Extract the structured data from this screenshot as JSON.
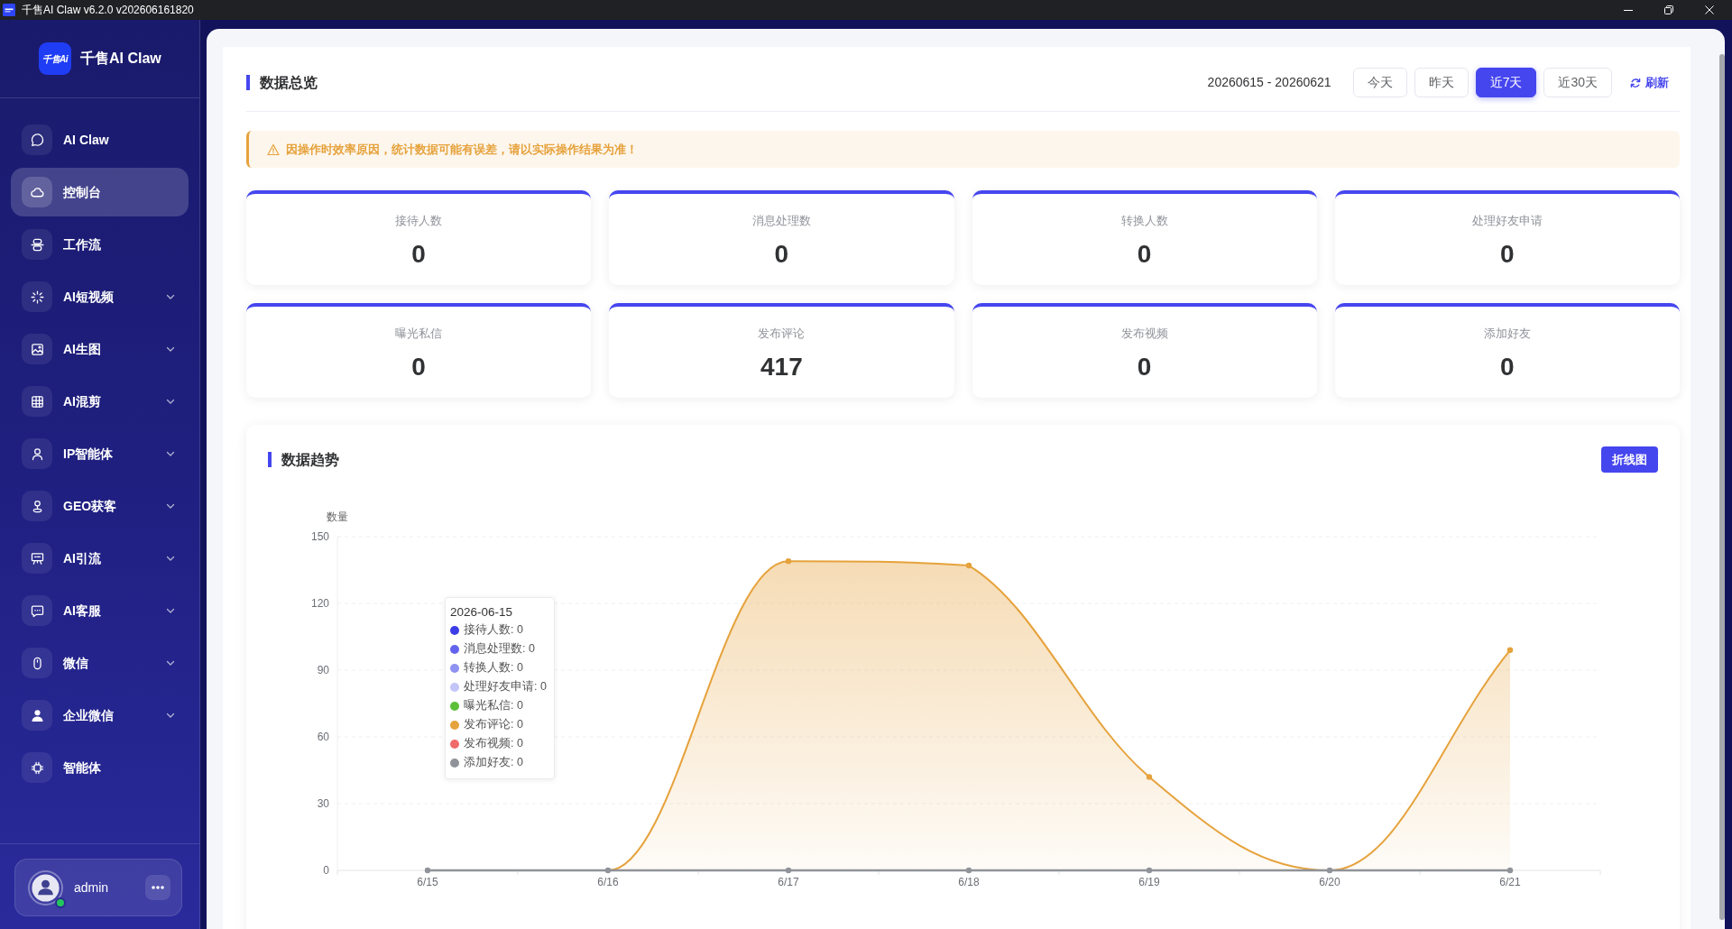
{
  "window": {
    "title": "千售AI Claw v6.2.0 v202606161820"
  },
  "sidebar": {
    "brand": {
      "logo_text": "千售Ai",
      "name": "千售AI Claw"
    },
    "items": [
      {
        "label": "AI Claw",
        "kind": "link",
        "selected": false,
        "expanded": false
      },
      {
        "label": "控制台",
        "kind": "link",
        "selected": true,
        "expanded": false
      },
      {
        "label": "工作流",
        "kind": "link",
        "selected": false,
        "expanded": false
      },
      {
        "label": "AI短视频",
        "kind": "group",
        "selected": false,
        "expanded": false
      },
      {
        "label": "AI生图",
        "kind": "group",
        "selected": false,
        "expanded": false
      },
      {
        "label": "AI混剪",
        "kind": "group",
        "selected": false,
        "expanded": false
      },
      {
        "label": "IP智能体",
        "kind": "group",
        "selected": false,
        "expanded": false
      },
      {
        "label": "GEO获客",
        "kind": "group",
        "selected": false,
        "expanded": false
      },
      {
        "label": "AI引流",
        "kind": "group",
        "selected": false,
        "expanded": false
      },
      {
        "label": "AI客服",
        "kind": "group",
        "selected": false,
        "expanded": false
      },
      {
        "label": "微信",
        "kind": "group",
        "selected": false,
        "expanded": false
      },
      {
        "label": "企业微信",
        "kind": "group",
        "selected": false,
        "expanded": false
      },
      {
        "label": "智能体",
        "kind": "link",
        "selected": false,
        "expanded": false
      }
    ],
    "user": {
      "name": "admin",
      "online": true
    }
  },
  "overview": {
    "title": "数据总览",
    "date_range": "20260615 - 20260621",
    "ranges": [
      {
        "label": "今天",
        "selected": false
      },
      {
        "label": "昨天",
        "selected": false
      },
      {
        "label": "近7天",
        "selected": true
      },
      {
        "label": "近30天",
        "selected": false
      }
    ],
    "refresh": "刷新",
    "notice": "因操作时效率原因，统计数据可能有误差，请以实际操作结果为准！",
    "stats": [
      {
        "label": "接待人数",
        "value": "0"
      },
      {
        "label": "消息处理数",
        "value": "0"
      },
      {
        "label": "转换人数",
        "value": "0"
      },
      {
        "label": "处理好友申请",
        "value": "0"
      },
      {
        "label": "曝光私信",
        "value": "0"
      },
      {
        "label": "发布评论",
        "value": "417"
      },
      {
        "label": "发布视频",
        "value": "0"
      },
      {
        "label": "添加好友",
        "value": "0"
      }
    ]
  },
  "trend": {
    "title": "数据趋势",
    "mode_button": "折线图",
    "chart_data": {
      "type": "area",
      "ylabel": "数量",
      "categories": [
        "6/15",
        "6/16",
        "6/17",
        "6/18",
        "6/19",
        "6/20",
        "6/21"
      ],
      "series": [
        {
          "color": "#e6a23c",
          "marker": "circle",
          "values": [
            0,
            0,
            139,
            137,
            42,
            0,
            99
          ]
        },
        {
          "type": "line",
          "color": "#909399",
          "marker": "circle",
          "values": [
            0,
            0,
            0,
            0,
            0,
            0,
            0
          ]
        }
      ],
      "ylim": [
        0,
        150
      ],
      "yticks": [
        0,
        30,
        60,
        90,
        120,
        150
      ],
      "stacked": false,
      "grid": true
    },
    "tooltip": {
      "title": "2026-06-15",
      "items": [
        {
          "label": "接待人数: 0",
          "color": "#3d3de8"
        },
        {
          "label": "消息处理数: 0",
          "color": "#6264ee"
        },
        {
          "label": "转换人数: 0",
          "color": "#8f92f2"
        },
        {
          "label": "处理好友申请: 0",
          "color": "#c3c4f7"
        },
        {
          "label": "曝光私信: 0",
          "color": "#5cbf3a"
        },
        {
          "label": "发布评论: 0",
          "color": "#e6a23c"
        },
        {
          "label": "发布视频: 0",
          "color": "#f06a6a"
        },
        {
          "label": "添加好友: 0",
          "color": "#909399"
        }
      ]
    }
  }
}
